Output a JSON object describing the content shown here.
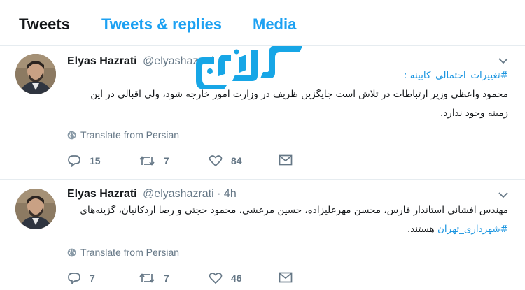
{
  "tabs": [
    {
      "label": "Tweets"
    },
    {
      "label": "Tweets & replies"
    },
    {
      "label": "Media"
    }
  ],
  "tweets": [
    {
      "name": "Elyas Hazrati",
      "handle": "@elyashazrati",
      "time": "",
      "hashtag_line": "#تغییرات_احتمالی_کابینه :",
      "text_line1": "محمود واعظی وزیر ارتباطات در تلاش است جایگزین ظریف در وزارت امور خارجه شود، ولی اقبالی در این",
      "text_line2": "زمینه وجود ندارد.",
      "translate": "Translate from Persian",
      "replies": "15",
      "retweets": "7",
      "likes": "84"
    },
    {
      "name": "Elyas Hazrati",
      "handle": "@elyashazrati",
      "time": "· 4h",
      "text_line1": "مهندس افشانی استاندار فارس، محسن مهرعلیزاده، حسین مرعشی، محمود حجتی و رضا اردکانیان، گزینه‌های",
      "text_line2_hashtag": "#شهرداری_تهران",
      "text_line2_rest": " هستند.",
      "translate": "Translate from Persian",
      "replies": "7",
      "retweets": "7",
      "likes": "46"
    }
  ],
  "icons": {
    "caret": "chevron-down-icon",
    "globe": "globe-icon",
    "reply": "reply-icon",
    "retweet": "retweet-icon",
    "like": "heart-icon",
    "message": "envelope-icon"
  },
  "colors": {
    "accent": "#1da1f2",
    "hashtag": "#1b95e0",
    "muted": "#657786",
    "divider": "#e6ecf0",
    "watermark": "#17a6e6"
  }
}
